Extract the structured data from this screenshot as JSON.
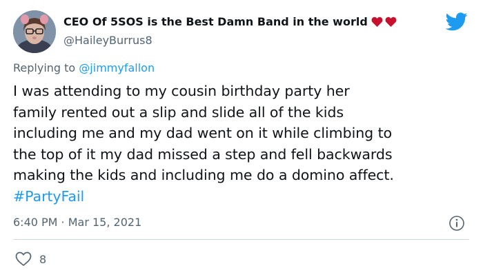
{
  "author": {
    "display_name": "CEO Of 5SOS is the Best Damn Band in the world",
    "handle": "@HaileyBurrus8",
    "name_emoji": [
      "heart-icon",
      "heart-icon"
    ]
  },
  "reply": {
    "prefix": "Replying to",
    "mention": "@jimmyfallon"
  },
  "tweet": {
    "lines": [
      "I was attending to my cousin birthday party her",
      "family rented out a slip and slide all of the kids",
      "including me and my dad went on it while climbing to",
      "the top of it my dad missed a step and fell backwards",
      "making the kids and including me do a domino affect."
    ],
    "hashtag": "#PartyFail",
    "timestamp": "6:40 PM · Mar 15, 2021"
  },
  "engagement": {
    "likes": "8"
  },
  "colors": {
    "accent": "#1d9bf0",
    "heart": "#c8102e",
    "secondary_text": "#536471"
  }
}
